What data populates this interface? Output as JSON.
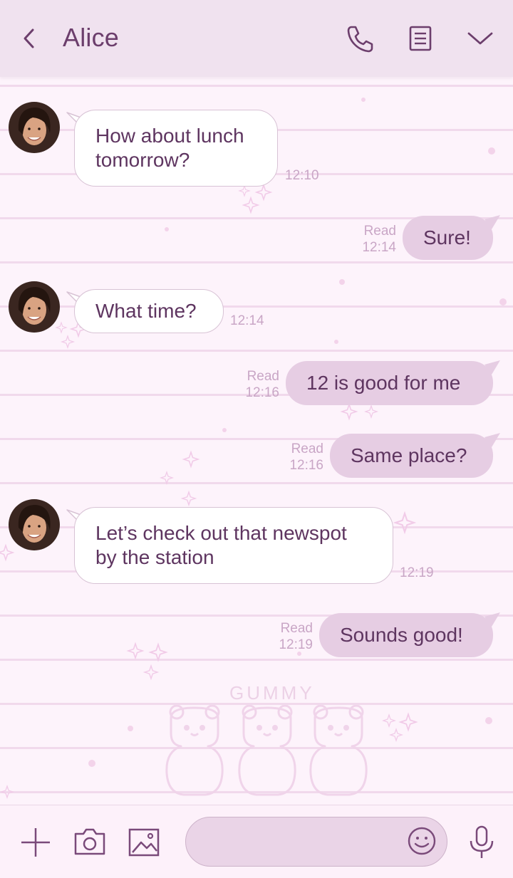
{
  "header": {
    "title": "Alice",
    "icons": [
      "back-chevron-icon",
      "phone-icon",
      "notes-icon",
      "chevron-down-icon"
    ]
  },
  "messages": [
    {
      "from": "Alice",
      "direction": "incoming",
      "lines": [
        "How about lunch",
        "tomorrow?"
      ],
      "time": "12:10"
    },
    {
      "from": "me",
      "direction": "outgoing",
      "text": "Sure!",
      "read": "Read",
      "time": "12:14"
    },
    {
      "from": "Alice",
      "direction": "incoming",
      "lines": [
        "What time?"
      ],
      "time": "12:14"
    },
    {
      "from": "me",
      "direction": "outgoing",
      "text": "12 is good for me",
      "read": "Read",
      "time": "12:16"
    },
    {
      "from": "me",
      "direction": "outgoing",
      "text": "Same place?",
      "read": "Read",
      "time": "12:16"
    },
    {
      "from": "Alice",
      "direction": "incoming",
      "lines": [
        "Let’s check out that newspot",
        "by the station"
      ],
      "time": "12:19"
    },
    {
      "from": "me",
      "direction": "outgoing",
      "text": "Sounds good!",
      "read": "Read",
      "time": "12:19"
    }
  ],
  "background": {
    "watermark": "GUMMY"
  },
  "composer": {
    "placeholder": "",
    "icons": [
      "plus-icon",
      "camera-icon",
      "image-icon",
      "smiley-icon",
      "microphone-icon"
    ]
  },
  "colors": {
    "header_bg": "#f0e2ef",
    "accent": "#6c3e6c",
    "outgoing_bubble": "#e6cde3",
    "incoming_bubble": "#ffffff",
    "meta_text": "#c9a6c6"
  }
}
